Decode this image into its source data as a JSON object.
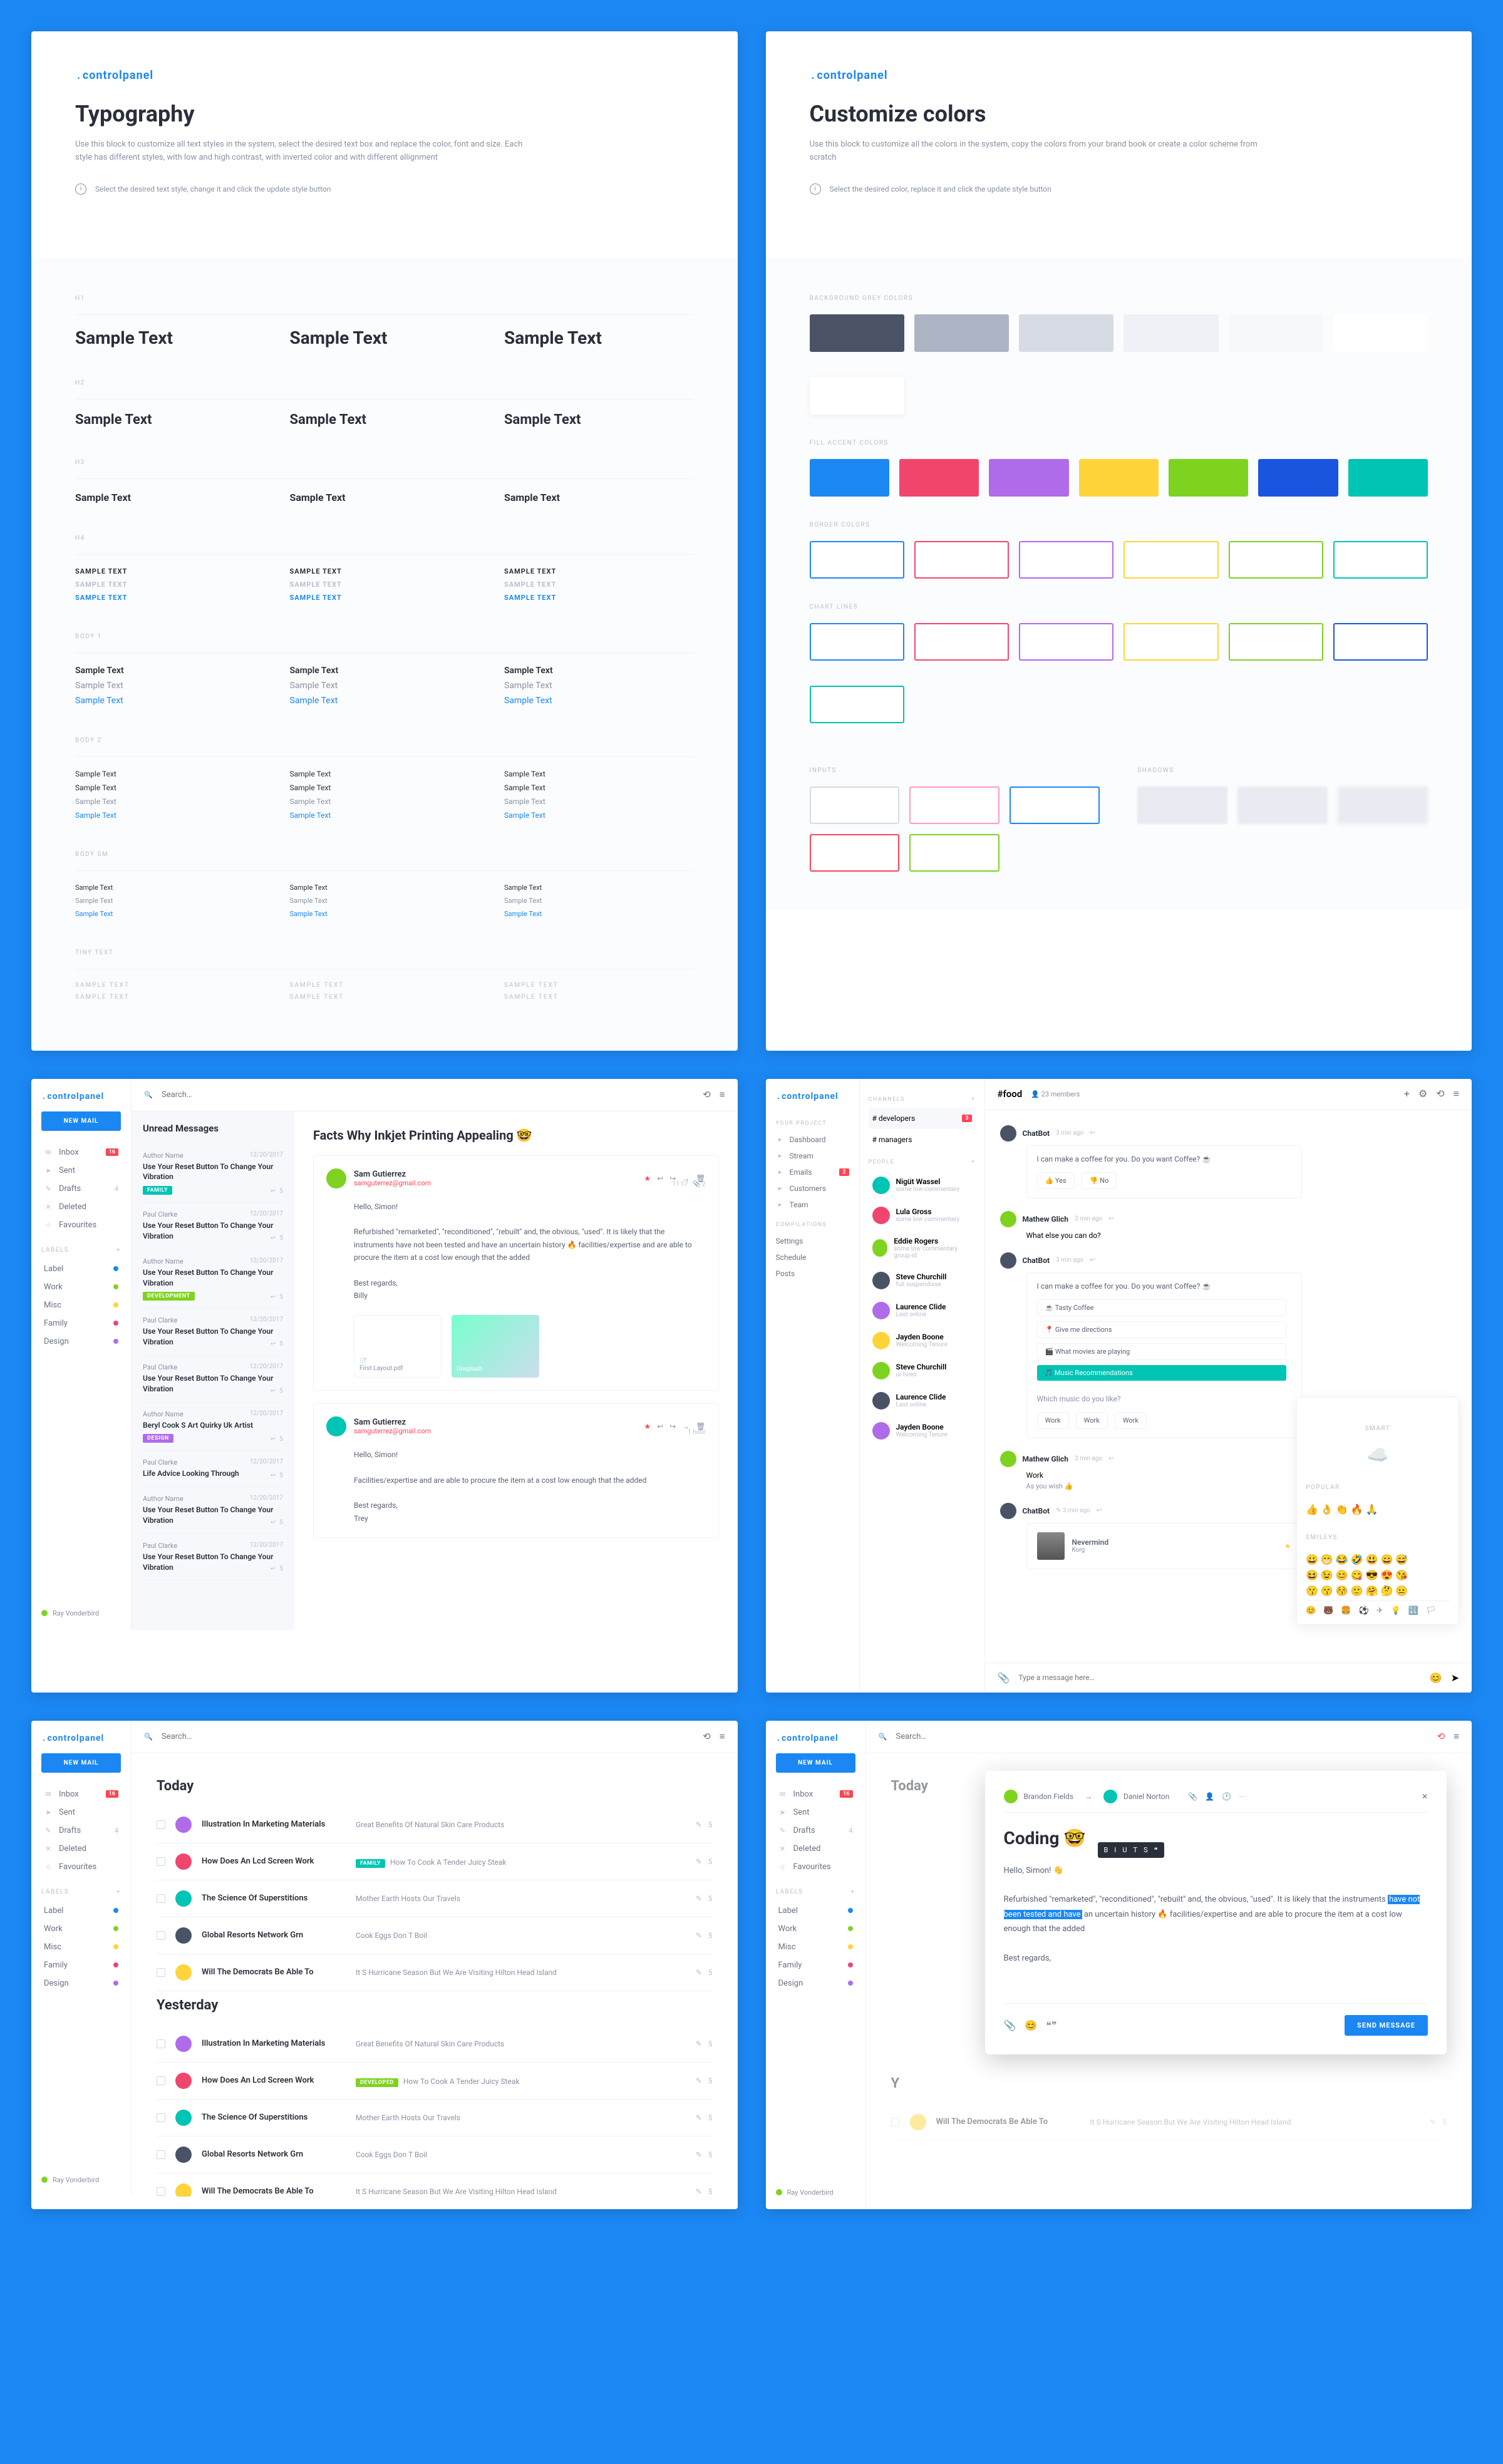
{
  "brand": "controlpanel",
  "typography": {
    "title": "Typography",
    "intro": "Use this block to customize all text styles in the system, select the desired text box and replace the color, font and size. Each style has different styles, with low and high contrast, with inverted color and with different allignment",
    "tip": "Select the desired text style, change it and click the update style button",
    "sample": "Sample Text",
    "sample_uc": "SAMPLE TEXT",
    "labels": {
      "h1": "H1",
      "h2": "H2",
      "h3": "H3",
      "h4": "H4",
      "body1": "BODY 1",
      "body2": "BODY 2",
      "body_sm": "BODY SM",
      "tiny": "TINY TEXT"
    }
  },
  "colors": {
    "title": "Customize colors",
    "intro": "Use this block to customize all the colors in the system, copy the colors from your brand book or create a color scheme from scratch",
    "tip": "Select the desired color, replace it and click the update style button",
    "groups": {
      "bg": "BACKGROUND GREY COLORS",
      "accent": "FILL ACCENT COLORS",
      "border": "BORDER COLORS",
      "chart": "CHART LINES",
      "inputs": "INPUTS",
      "shadows": "SHADOWS"
    },
    "bg": [
      "#4a5265",
      "#adb4c4",
      "#d7dbe4",
      "#eef1f6",
      "#f7f8fb",
      "#ffffff"
    ],
    "accent": [
      "#1b87f3",
      "#f0466e",
      "#b06bea",
      "#ffd43b",
      "#7ed321",
      "#1a55e0",
      "#00c4b4"
    ],
    "border": [
      "#1b87f3",
      "#f0466e",
      "#b06bea",
      "#ffd43b",
      "#7ed321",
      "#00c4b4"
    ],
    "chart": [
      "#1b87f3",
      "#f0466e",
      "#b06bea",
      "#ffd43b",
      "#7ed321",
      "#1a55e0",
      "#00c4b4"
    ]
  },
  "sidebar": {
    "new": "NEW MAIL",
    "items": [
      {
        "icon": "✉",
        "label": "Inbox",
        "badge": "16"
      },
      {
        "icon": "➤",
        "label": "Sent"
      },
      {
        "icon": "✎",
        "label": "Drafts",
        "count": "4"
      },
      {
        "icon": "✕",
        "label": "Deleted"
      },
      {
        "icon": "☆",
        "label": "Favourites"
      }
    ],
    "labels_hdr": "LABELS",
    "labels": [
      {
        "color": "#1b87f3",
        "name": "Label"
      },
      {
        "color": "#7ed321",
        "name": "Work"
      },
      {
        "color": "#ffd43b",
        "name": "Misc"
      },
      {
        "color": "#f0466e",
        "name": "Family"
      },
      {
        "color": "#b06bea",
        "name": "Design"
      }
    ],
    "user": "Ray Vonderbird"
  },
  "search": "Search…",
  "mail": {
    "list_title": "Unread Messages",
    "items": [
      {
        "from": "Author Name",
        "subj": "Use Your Reset Button To Change Your Vibration",
        "date": "12/20/2017",
        "tag": "FAMILY",
        "tagc": "#00c4b4"
      },
      {
        "from": "Paul Clarke",
        "subj": "Use Your Reset Button To Change Your Vibration",
        "date": "12/20/2017"
      },
      {
        "from": "Author Name",
        "subj": "Use Your Reset Button To Change Your Vibration",
        "date": "12/20/2017",
        "tag": "DEVELOPMENT",
        "tagc": "#7ed321"
      },
      {
        "from": "Paul Clarke",
        "subj": "Use Your Reset Button To Change Your Vibration",
        "date": "12/20/2017"
      },
      {
        "from": "Paul Clarke",
        "subj": "Use Your Reset Button To Change Your Vibration",
        "date": "12/20/2017"
      },
      {
        "from": "Author Name",
        "subj": "Beryl Cook S Art Quirky Uk Artist",
        "date": "12/20/2017",
        "tag": "DESIGN",
        "tagc": "#b06bea"
      },
      {
        "from": "Paul Clarke",
        "subj": "Life Advice Looking Through",
        "date": "12/20/2017"
      },
      {
        "from": "Author Name",
        "subj": "Use Your Reset Button To Change Your Vibration",
        "date": "12/20/2017"
      },
      {
        "from": "Paul Clarke",
        "subj": "Use Your Reset Button To Change Your Vibration",
        "date": "12/20/2017"
      }
    ],
    "thread_title": "Facts Why Inkjet  Printing Appealing 🤓",
    "sender": "Sam Gutierrez",
    "email": "samguterrez@gmail.com",
    "time": "11:17",
    "attcount": "2",
    "greet": "Hello, Simon!",
    "body1": "Refurbished  \"remarketed\", \"reconditioned\", \"rebuilt\" and, the obvious, \"used\". It is likely that the instruments have not been tested and have an uncertain history 🔥  facilities/expertise and are able to procure the item at a cost low enough that the added",
    "regards": "Best regards,",
    "sig1": "Billy",
    "sig2": "Trey",
    "att1": "First Layout.pdf",
    "att2": "Unsplash",
    "body2": "Facilities/expertise and are able to procure the item at a cost low enough that the added"
  },
  "inbox": {
    "today": "Today",
    "yesterday": "Yesterday",
    "rows": [
      {
        "c": "#b06bea",
        "t": "Illustration In Marketing Materials",
        "p": "Great Benefits Of Natural Skin Care Products"
      },
      {
        "c": "#f0466e",
        "t": "How Does An Lcd Screen Work",
        "tag": "FAMILY",
        "tagc": "#00c4b4",
        "p": "How To Cook A Tender Juicy Steak"
      },
      {
        "c": "#00c4b4",
        "t": "The Science Of Superstitions",
        "p": "Mother Earth Hosts Our Travels"
      },
      {
        "c": "#4a5265",
        "t": "Global Resorts Network Grn",
        "p": "Cook Eggs Don T Boil"
      },
      {
        "c": "#ffd43b",
        "t": "Will The Democrats Be Able To",
        "p": "It S Hurricane Season But We Are Visiting Hilton Head Island"
      }
    ],
    "rows2": [
      {
        "c": "#b06bea",
        "t": "Illustration In Marketing Materials",
        "p": "Great Benefits Of Natural Skin Care Products"
      },
      {
        "c": "#f0466e",
        "t": "How Does An Lcd Screen Work",
        "tag": "DEVELOPED",
        "tagc": "#7ed321",
        "p": "How To Cook A Tender Juicy Steak"
      },
      {
        "c": "#00c4b4",
        "t": "The Science Of Superstitions",
        "p": "Mother Earth Hosts Our Travels"
      },
      {
        "c": "#4a5265",
        "t": "Global Resorts Network Grn",
        "p": "Cook Eggs Don T Boil"
      },
      {
        "c": "#ffd43b",
        "t": "Will The Democrats Be Able To",
        "p": "It S Hurricane Season But We Are Visiting Hilton Head Island"
      }
    ]
  },
  "chat": {
    "proj_hdr": "YOUR PROJECT",
    "proj": [
      "Dashboard",
      "Stream",
      "Emails",
      "Customers",
      "Team"
    ],
    "comp_hdr": "COMPILATIONS",
    "comp": [
      "Settings",
      "Schedule",
      "Posts"
    ],
    "ch_hdr": "CHANNELS",
    "channels": [
      "# developers",
      "# managers"
    ],
    "pp_hdr": "PEOPLE",
    "people": [
      {
        "n": "Nigüt Wassel",
        "s": "some low commentary"
      },
      {
        "n": "Lula Gross",
        "s": "some low commentary"
      },
      {
        "n": "Eddie Rogers",
        "s": "some low commentary group-id"
      },
      {
        "n": "Steve Churchill",
        "s": "full suspendisse"
      },
      {
        "n": "Laurence Clide",
        "s": "Last online"
      },
      {
        "n": "Jayden Boone",
        "s": "Welcoming Tenure"
      },
      {
        "n": "Steve Churchill",
        "s": "ur hires"
      },
      {
        "n": "Laurence Clide",
        "s": "Last online"
      },
      {
        "n": "Jayden Boone",
        "s": "Welcoming Tenure"
      }
    ],
    "title": "#food",
    "members": "23 members",
    "bot": "ChatBot",
    "bot_ts": "3 min ago",
    "bot_q": "I can make a coffee for you. Do you want Coffee? ☕",
    "yes": "👍 Yes",
    "no": "👎 No",
    "user": "Mathew Glich",
    "user_ts": "3 min ago",
    "user_msg": "What else you can do?",
    "opts": [
      "☕ Tasty Coffee",
      "📍 Give me directions",
      "🎬 What movies are playing",
      "🎵 Music Recommendations"
    ],
    "bot_q2": "Which music do you like?",
    "chips": [
      "Work",
      "Work",
      "Work"
    ],
    "user2_msg": "Work",
    "user2_sub": "As you wish 👍",
    "now_playing": "Nevermind",
    "now_artist": "Korg",
    "input": "Type a message here…",
    "popover": {
      "hdr": "Smart",
      "popular": "POPULAR",
      "smileys": "SMILEYS"
    }
  },
  "compose": {
    "from": "Brandon Fields",
    "to": "Daniel Norton",
    "subject": "Coding 🤓",
    "greet": "Hello, Simon! 👋",
    "body_a": "Refurbished  \"remarketed\", \"reconditioned\", \"rebuilt\" and, the obvious, \"used\". It is likely that the instruments ",
    "body_hl": "have not been tested and have",
    "body_b": " an uncertain history 🔥  facilities/expertise and are able to procure the item at a cost low enough that the added",
    "regards": "Best regards,",
    "send": "SEND MESSAGE",
    "fmt": [
      "B",
      "I",
      "U",
      "T",
      "S",
      "❝"
    ]
  }
}
